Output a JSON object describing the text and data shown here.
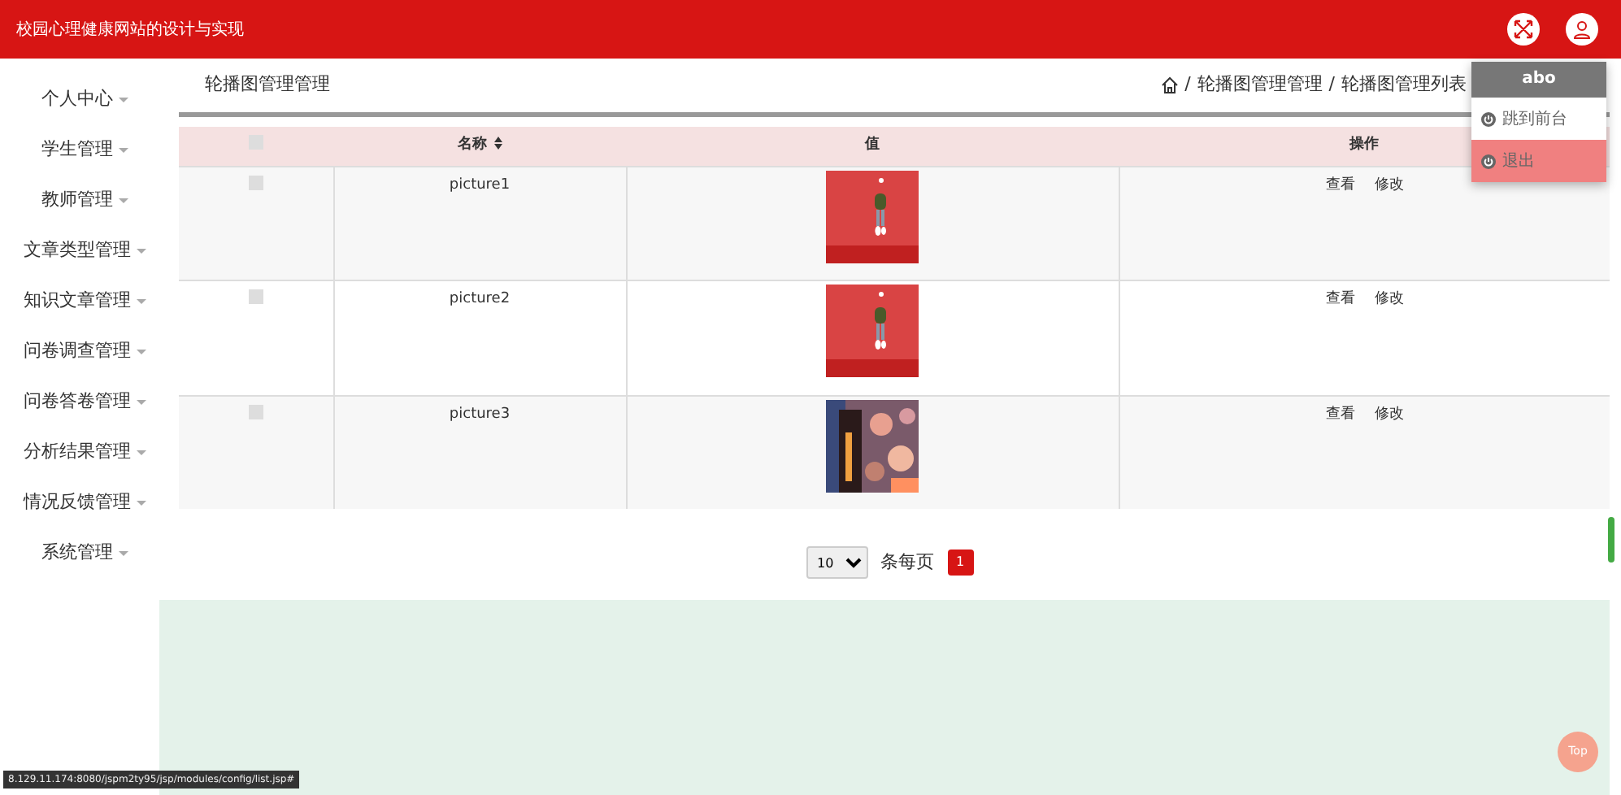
{
  "header": {
    "title": "校园心理健康网站的设计与实现"
  },
  "sidebar": {
    "items": [
      {
        "label": "个人中心"
      },
      {
        "label": "学生管理"
      },
      {
        "label": "教师管理"
      },
      {
        "label": "文章类型管理"
      },
      {
        "label": "知识文章管理"
      },
      {
        "label": "问卷调查管理"
      },
      {
        "label": "问卷答卷管理"
      },
      {
        "label": "分析结果管理"
      },
      {
        "label": "情况反馈管理"
      },
      {
        "label": "系统管理"
      }
    ]
  },
  "page_title": "轮播图管理管理",
  "breadcrumb": {
    "separator": "/",
    "items": [
      "轮播图管理管理",
      "轮播图管理列表"
    ]
  },
  "user_menu": {
    "username": "abo",
    "items": [
      {
        "label": "跳到前台",
        "kind": "link"
      },
      {
        "label": "退出",
        "kind": "danger"
      }
    ]
  },
  "table": {
    "header_checked": false,
    "columns": [
      "名称",
      "值",
      "操作"
    ],
    "rows": [
      {
        "checked": false,
        "name": "picture1",
        "value": {
          "kind": "picture",
          "color": "#d94444"
        },
        "actions": [
          "查看",
          "修改"
        ]
      },
      {
        "checked": false,
        "name": "picture2",
        "value": {
          "kind": "picture",
          "color": "#d94444"
        },
        "actions": [
          "查看",
          "修改"
        ]
      },
      {
        "checked": false,
        "name": "picture3",
        "value": {
          "kind": "picture",
          "color": "#7a5a6a"
        },
        "actions": [
          "查看",
          "修改"
        ]
      }
    ]
  },
  "pagination": {
    "page_size": "10",
    "per_page_label": "条每页",
    "pages": [
      {
        "label": "1",
        "selected": true
      }
    ]
  },
  "back_to_top": "Top",
  "status_url": "8.129.11.174:8080/jspm2ty95/jsp/modules/config/list.jsp#"
}
